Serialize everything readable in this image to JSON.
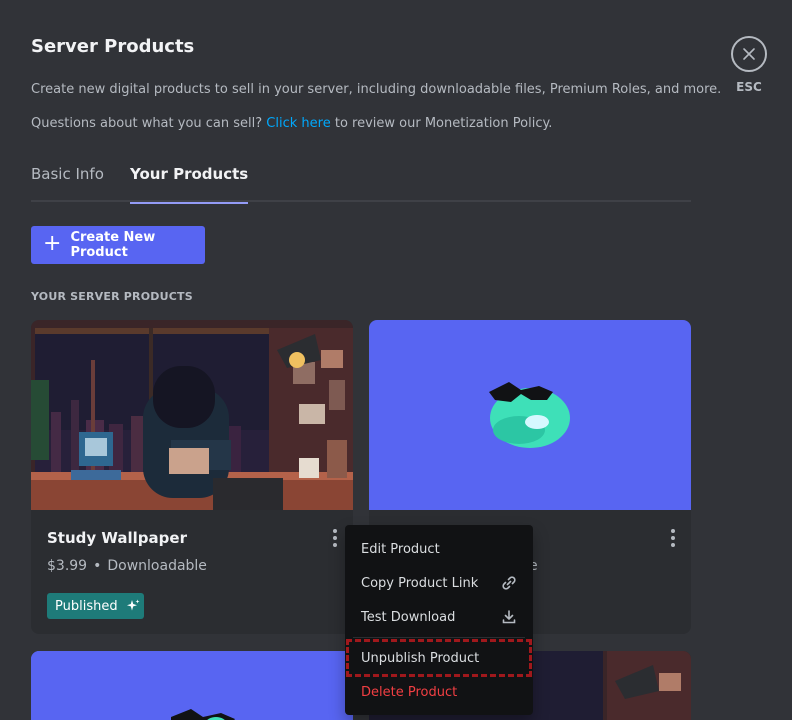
{
  "header": {
    "title": "Server Products",
    "description": "Create new digital products to sell in your server, including downloadable files, Premium Roles, and more.",
    "question_prefix": "Questions about what you can sell?",
    "link_text": "Click here",
    "question_suffix": "to review our Monetization Policy."
  },
  "close": {
    "icon": "close-icon",
    "label": "ESC"
  },
  "tabs": [
    {
      "label": "Basic Info",
      "active": false
    },
    {
      "label": "Your Products",
      "active": true
    }
  ],
  "create_button": {
    "label": "Create New Product",
    "icon": "plus-icon"
  },
  "section_label": "YOUR SERVER PRODUCTS",
  "products": [
    {
      "name": "Study Wallpaper",
      "price": "$3.99",
      "separator": "•",
      "type": "Downloadable",
      "status": "Published"
    },
    {
      "name": "",
      "price": "",
      "type_tail": "e"
    }
  ],
  "context_menu": {
    "items": [
      {
        "label": "Edit Product",
        "icon": ""
      },
      {
        "label": "Copy Product Link",
        "icon": "link-icon"
      },
      {
        "label": "Test Download",
        "icon": "download-icon"
      },
      {
        "label": "Unpublish Product",
        "icon": ""
      },
      {
        "label": "Delete Product",
        "icon": ""
      }
    ]
  },
  "colors": {
    "background": "#313338",
    "accent": "#5865f2",
    "link": "#00a8fc",
    "published_badge": "#1e7b79",
    "danger": "#f23f43",
    "highlight": "#a0181c"
  }
}
